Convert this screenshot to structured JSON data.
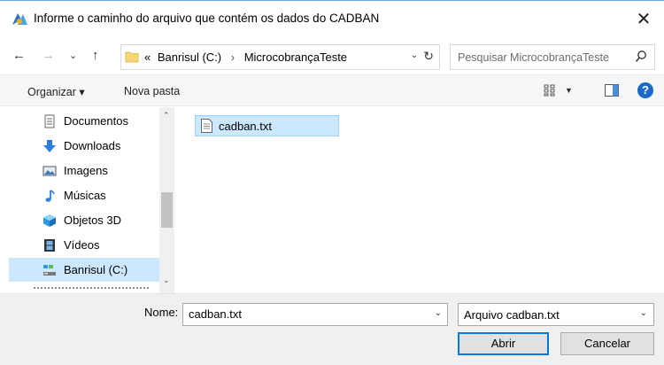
{
  "window": {
    "title": "Informe o caminho do arquivo que contém os dados do CADBAN",
    "app_icon": "app-icon",
    "close_glyph": "✕"
  },
  "nav_buttons": {
    "back": "←",
    "forward": "→",
    "recent": "⌄",
    "up": "↑"
  },
  "address": {
    "overflow": "«",
    "crumbs": [
      "Banrisul (C:)",
      "MicrocobrançaTeste"
    ],
    "separator": "›",
    "dropdown": "⌄",
    "refresh": "↻"
  },
  "search": {
    "placeholder": "Pesquisar MicrocobrançaTeste",
    "icon": "search-icon"
  },
  "toolbar": {
    "organize_label": "Organizar ▾",
    "new_folder_label": "Nova pasta",
    "help_label": "?"
  },
  "sidebar": {
    "items": [
      {
        "label": "Documentos",
        "icon": "documents-icon",
        "selected": false
      },
      {
        "label": "Downloads",
        "icon": "download-icon",
        "selected": false
      },
      {
        "label": "Imagens",
        "icon": "images-icon",
        "selected": false
      },
      {
        "label": "Músicas",
        "icon": "music-icon",
        "selected": false
      },
      {
        "label": "Objetos 3D",
        "icon": "3d-objects-icon",
        "selected": false
      },
      {
        "label": "Vídeos",
        "icon": "videos-icon",
        "selected": false
      },
      {
        "label": "Banrisul (C:)",
        "icon": "drive-icon",
        "selected": true
      }
    ],
    "scroll_up": "⌃",
    "scroll_down": "⌄"
  },
  "files": [
    {
      "label": "cadban.txt",
      "icon": "text-file-icon",
      "selected": true
    }
  ],
  "bottom": {
    "name_label": "Nome:",
    "name_value": "cadban.txt",
    "filter_value": "Arquivo cadban.txt",
    "open_label": "Abrir",
    "cancel_label": "Cancelar",
    "dropdown_glyph": "⌄"
  },
  "colors": {
    "accent": "#0078d7",
    "selection": "#cce8ff",
    "selection_border": "#99d1ff",
    "help_blue": "#1b6ac9"
  }
}
